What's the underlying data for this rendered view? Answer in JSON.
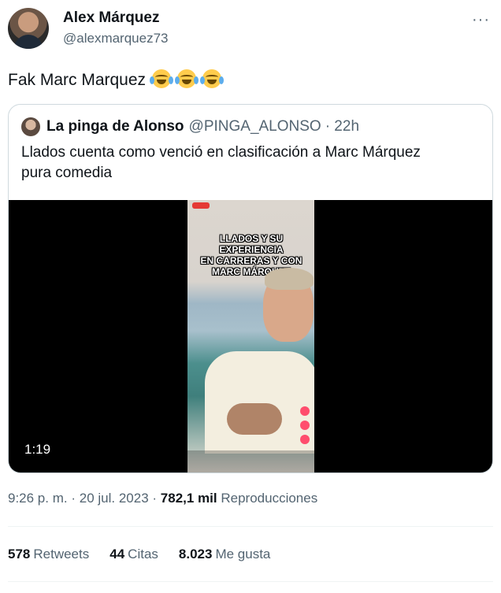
{
  "author": {
    "display_name": "Alex Márquez",
    "handle": "@alexmarquez73"
  },
  "tweet": {
    "text": "Fak Marc Marquez",
    "emojis": [
      "face-with-tears-of-joy",
      "face-with-tears-of-joy",
      "face-with-tears-of-joy"
    ]
  },
  "quoted_tweet": {
    "display_name": "La pinga de Alonso",
    "handle": "@PINGA_ALONSO",
    "time": "· 22h",
    "text_line1": "Llados cuenta como venció en clasificación a Marc Márquez",
    "text_line2": "pura comedia",
    "video": {
      "duration": "1:19",
      "overlay_line1": "LLADOS Y SU EXPERIENCIA",
      "overlay_line2": "EN CARRERAS Y CON",
      "overlay_line3": "MARC MÁRQUEZ"
    }
  },
  "meta": {
    "time": "9:26 p. m.",
    "sep1": "·",
    "date": "20 jul. 2023",
    "sep2": "·",
    "views_count": "782,1 mil",
    "views_label": "Reproducciones"
  },
  "stats": {
    "retweets_count": "578",
    "retweets_label": "Retweets",
    "quotes_count": "44",
    "quotes_label": "Citas",
    "likes_count": "8.023",
    "likes_label": "Me gusta"
  },
  "colors": {
    "text_primary": "#0f1419",
    "text_secondary": "#536471",
    "border": "#cfd9de",
    "divider": "#eff3f4"
  }
}
